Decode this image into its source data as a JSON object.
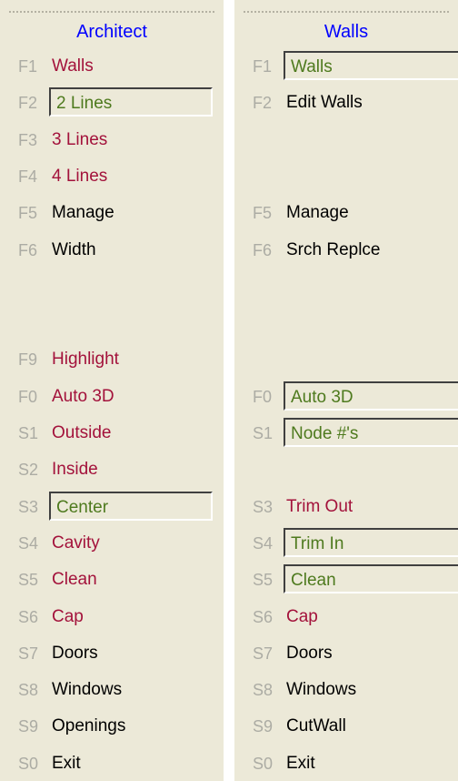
{
  "left_menu": {
    "title": "Architect",
    "items": [
      {
        "key": "F1",
        "label": "Walls",
        "state": "red",
        "row": 0
      },
      {
        "key": "F2",
        "label": "2 Lines",
        "state": "active",
        "row": 1
      },
      {
        "key": "F3",
        "label": "3 Lines",
        "state": "red",
        "row": 2
      },
      {
        "key": "F4",
        "label": "4 Lines",
        "state": "red",
        "row": 3
      },
      {
        "key": "F5",
        "label": "Manage",
        "state": "normal",
        "row": 4
      },
      {
        "key": "F6",
        "label": "Width",
        "state": "normal",
        "row": 5
      },
      {
        "key": "F9",
        "label": "Highlight",
        "state": "red",
        "row": 8
      },
      {
        "key": "F0",
        "label": "Auto 3D",
        "state": "red",
        "row": 9
      },
      {
        "key": "S1",
        "label": "Outside",
        "state": "red",
        "row": 10
      },
      {
        "key": "S2",
        "label": "Inside",
        "state": "red",
        "row": 11
      },
      {
        "key": "S3",
        "label": "Center",
        "state": "active",
        "row": 12
      },
      {
        "key": "S4",
        "label": "Cavity",
        "state": "red",
        "row": 13
      },
      {
        "key": "S5",
        "label": "Clean",
        "state": "red",
        "row": 14
      },
      {
        "key": "S6",
        "label": "Cap",
        "state": "red",
        "row": 15
      },
      {
        "key": "S7",
        "label": "Doors",
        "state": "normal",
        "row": 16
      },
      {
        "key": "S8",
        "label": "Windows",
        "state": "normal",
        "row": 17
      },
      {
        "key": "S9",
        "label": "Openings",
        "state": "normal",
        "row": 18
      },
      {
        "key": "S0",
        "label": "Exit",
        "state": "normal",
        "row": 19
      }
    ]
  },
  "right_menu": {
    "title": "Walls",
    "items": [
      {
        "key": "F1",
        "label": "Walls",
        "state": "active",
        "row": 0
      },
      {
        "key": "F2",
        "label": "Edit Walls",
        "state": "normal",
        "row": 1
      },
      {
        "key": "F5",
        "label": "Manage",
        "state": "normal",
        "row": 4
      },
      {
        "key": "F6",
        "label": "Srch Replce",
        "state": "normal",
        "row": 5
      },
      {
        "key": "F0",
        "label": "Auto 3D",
        "state": "active",
        "row": 9
      },
      {
        "key": "S1",
        "label": "Node #'s",
        "state": "active",
        "row": 10
      },
      {
        "key": "S3",
        "label": "Trim Out",
        "state": "red",
        "row": 12
      },
      {
        "key": "S4",
        "label": "Trim In",
        "state": "active",
        "row": 13
      },
      {
        "key": "S5",
        "label": "Clean",
        "state": "active",
        "row": 14
      },
      {
        "key": "S6",
        "label": "Cap",
        "state": "red",
        "row": 15
      },
      {
        "key": "S7",
        "label": "Doors",
        "state": "normal",
        "row": 16
      },
      {
        "key": "S8",
        "label": "Windows",
        "state": "normal",
        "row": 17
      },
      {
        "key": "S9",
        "label": "CutWall",
        "state": "normal",
        "row": 18
      },
      {
        "key": "S0",
        "label": "Exit",
        "state": "normal",
        "row": 19
      }
    ]
  },
  "colors": {
    "panel_bg": "#ece9d8",
    "title": "#0000ff",
    "key": "#acaca4",
    "normal": "#000000",
    "red": "#a3123b",
    "active": "#4e7a1e"
  }
}
